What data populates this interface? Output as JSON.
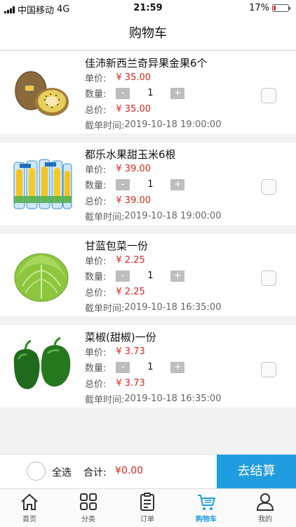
{
  "status_bar": {
    "carrier": "中国移动",
    "network": "4G",
    "time": "21:59",
    "battery": "17%",
    "battery_level": 0.17
  },
  "header": {
    "title": "购物车"
  },
  "labels": {
    "unit_price": "单价:",
    "quantity": "数量:",
    "total_price": "总价:",
    "deadline": "截单时间:",
    "minus": "-",
    "plus": "+"
  },
  "cart_items": [
    {
      "name": "佳沛新西兰奇异果金果6个",
      "unit_price": "¥ 35.00",
      "quantity": "1",
      "total_price": "¥ 35.00",
      "deadline": "2019-10-18 19:00:00",
      "image": "kiwi-fruit"
    },
    {
      "name": "都乐水果甜玉米6根",
      "unit_price": "¥ 39.00",
      "quantity": "1",
      "total_price": "¥ 39.00",
      "deadline": "2019-10-18 19:00:00",
      "image": "sweet-corn"
    },
    {
      "name": "甘蓝包菜一份",
      "unit_price": "¥ 2.25",
      "quantity": "1",
      "total_price": "¥ 2.25",
      "deadline": "2019-10-18 16:35:00",
      "image": "cabbage"
    },
    {
      "name": "菜椒(甜椒)一份",
      "unit_price": "¥ 3.73",
      "quantity": "1",
      "total_price": "¥ 3.73",
      "deadline": "2019-10-18 16:35:00",
      "image": "green-pepper"
    }
  ],
  "checkout": {
    "select_all": "全选",
    "total_label": "合计:",
    "total_value": "¥0.00",
    "button": "去结算"
  },
  "tabs": [
    {
      "label": "首页",
      "icon": "home-icon",
      "active": false
    },
    {
      "label": "分类",
      "icon": "category-icon",
      "active": false
    },
    {
      "label": "订单",
      "icon": "orders-icon",
      "active": false
    },
    {
      "label": "购物车",
      "icon": "cart-icon",
      "active": true
    },
    {
      "label": "我的",
      "icon": "profile-icon",
      "active": false
    }
  ],
  "colors": {
    "accent": "#1f9de0",
    "price": "#d9281f",
    "battery_low": "#e23030"
  }
}
